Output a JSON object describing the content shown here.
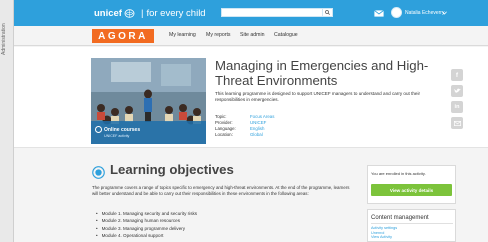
{
  "admin": {
    "label": "Administration"
  },
  "header": {
    "brand_name": "unicef",
    "brand_slogan": "for every child",
    "search_value": "",
    "user_name": "Natalia Echeverry",
    "colors": {
      "topbar": "#2ea0dc"
    }
  },
  "nav": {
    "logo_text": "AGORA",
    "items": [
      "My learning",
      "My reports",
      "Site admin",
      "Catalogue"
    ],
    "colors": {
      "logo": "#f26b21"
    }
  },
  "course": {
    "title": "Managing in Emergencies and High-Threat Environments",
    "description": "This learning programme is designed to support UNICEF managers to understand and carry out their responsibilities in emergencies.",
    "badge_label": "Online courses",
    "badge_sub": "UNICEF activity",
    "meta": [
      {
        "key": "Topic:",
        "value": "Focus Areas"
      },
      {
        "key": "Provider:",
        "value": "UNICEF"
      },
      {
        "key": "Language:",
        "value": "English"
      },
      {
        "key": "Location:",
        "value": "Global"
      }
    ],
    "share_icons": [
      "facebook-icon",
      "twitter-icon",
      "linkedin-icon",
      "email-icon"
    ]
  },
  "objectives": {
    "title": "Learning objectives",
    "description": "The programme covers a range of topics specific to emergency and high-threat environments. At the end of the programme, learners will better understand and be able to carry out their responsibilities in these environments in the following areas:",
    "modules": [
      "Module 1. Managing security and security risks",
      "Module 2. Managing human resources",
      "Module 3. Managing programme delivery",
      "Module 4. Operational support"
    ]
  },
  "enrolment": {
    "message": "You are enrolled in this activity.",
    "button_label": "View activity details",
    "colors": {
      "button": "#7cc33b"
    }
  },
  "content_management": {
    "title": "Content management",
    "links": [
      "Activity settings",
      "Unenrol",
      "View Activity"
    ]
  }
}
